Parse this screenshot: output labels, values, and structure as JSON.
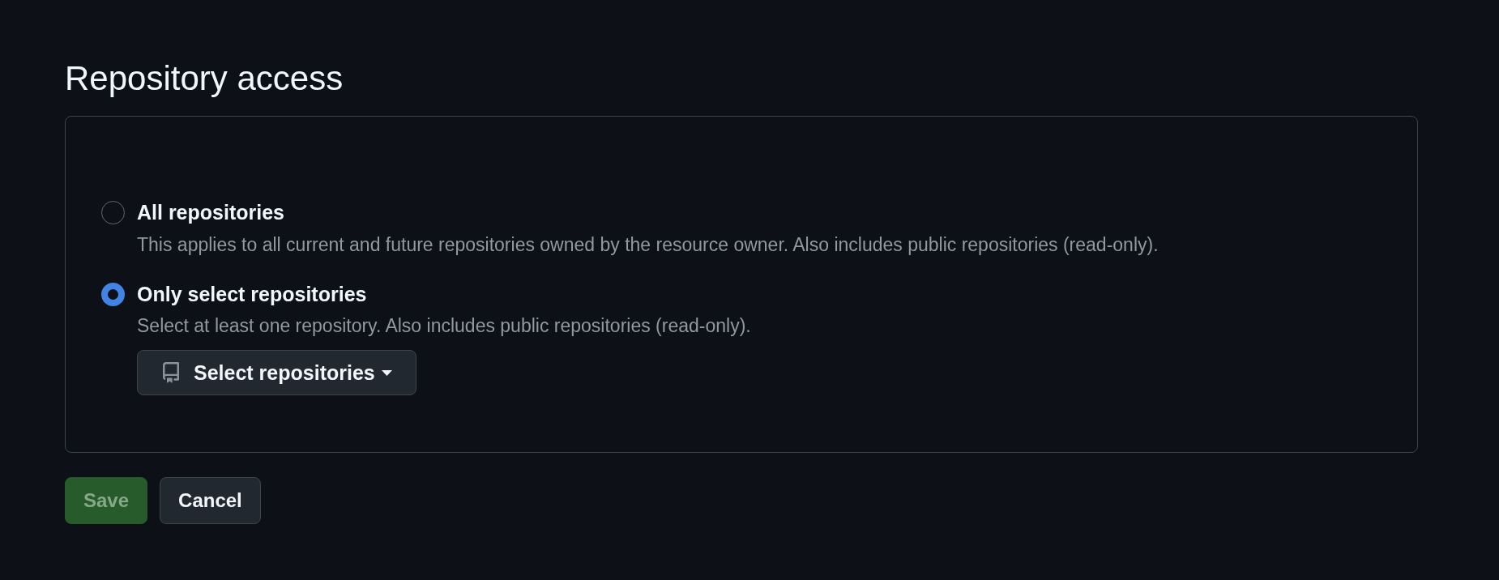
{
  "title": "Repository access",
  "options": [
    {
      "label": "All repositories",
      "description": "This applies to all current and future repositories owned by the resource owner. Also includes public repositories (read-only).",
      "selected": false
    },
    {
      "label": "Only select repositories",
      "description": "Select at least one repository. Also includes public repositories (read-only).",
      "selected": true,
      "dropdown": {
        "label": "Select repositories"
      }
    }
  ],
  "buttons": [
    {
      "label": "Save",
      "kind": "primary",
      "disabled": true
    },
    {
      "label": "Cancel",
      "kind": "secondary",
      "disabled": false
    }
  ]
}
